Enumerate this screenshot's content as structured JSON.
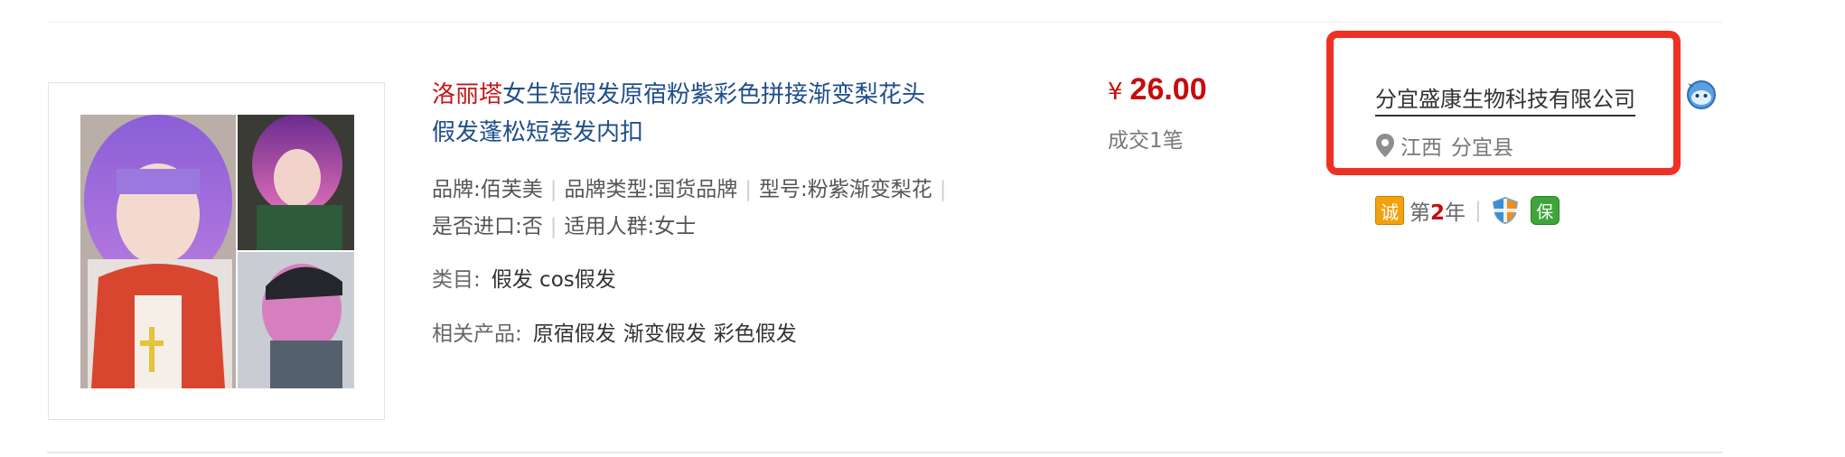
{
  "product": {
    "title_highlight": "洛丽塔",
    "title_line1_rest": "女生短假发原宿粉紫彩色拼接渐变梨花头",
    "title_line2": "假发蓬松短卷发内扣",
    "attributes": [
      {
        "text": "品牌:佰芙美"
      },
      {
        "text": "品牌类型:国货品牌"
      },
      {
        "text": "型号:粉紫渐变梨花"
      },
      {
        "text": "是否进口:否"
      },
      {
        "text": "适用人群:女士"
      }
    ],
    "category_label": "类目:",
    "category_value": "假发 cos假发",
    "related_label": "相关产品:",
    "related": [
      "原宿假发",
      "渐变假发",
      "彩色假发"
    ]
  },
  "price": {
    "currency": "¥",
    "amount": "26.00",
    "deals": "成交1笔"
  },
  "shop": {
    "name": "分宜盛康生物科技有限公司",
    "province": "江西",
    "city": "分宜县",
    "badge_cheng": "诚",
    "years_prefix": "第",
    "years_num": "2",
    "years_suffix": "年",
    "badge_bao": "保"
  },
  "colors": {
    "title": "#1f4e8c",
    "title_highlight": "#c21a1a",
    "price": "#c50d0d",
    "annotation_box": "#ee3124"
  },
  "icons": {
    "location": "map-pin-icon",
    "chat": "wangwang-chat-icon",
    "shield": "shield-icon"
  }
}
